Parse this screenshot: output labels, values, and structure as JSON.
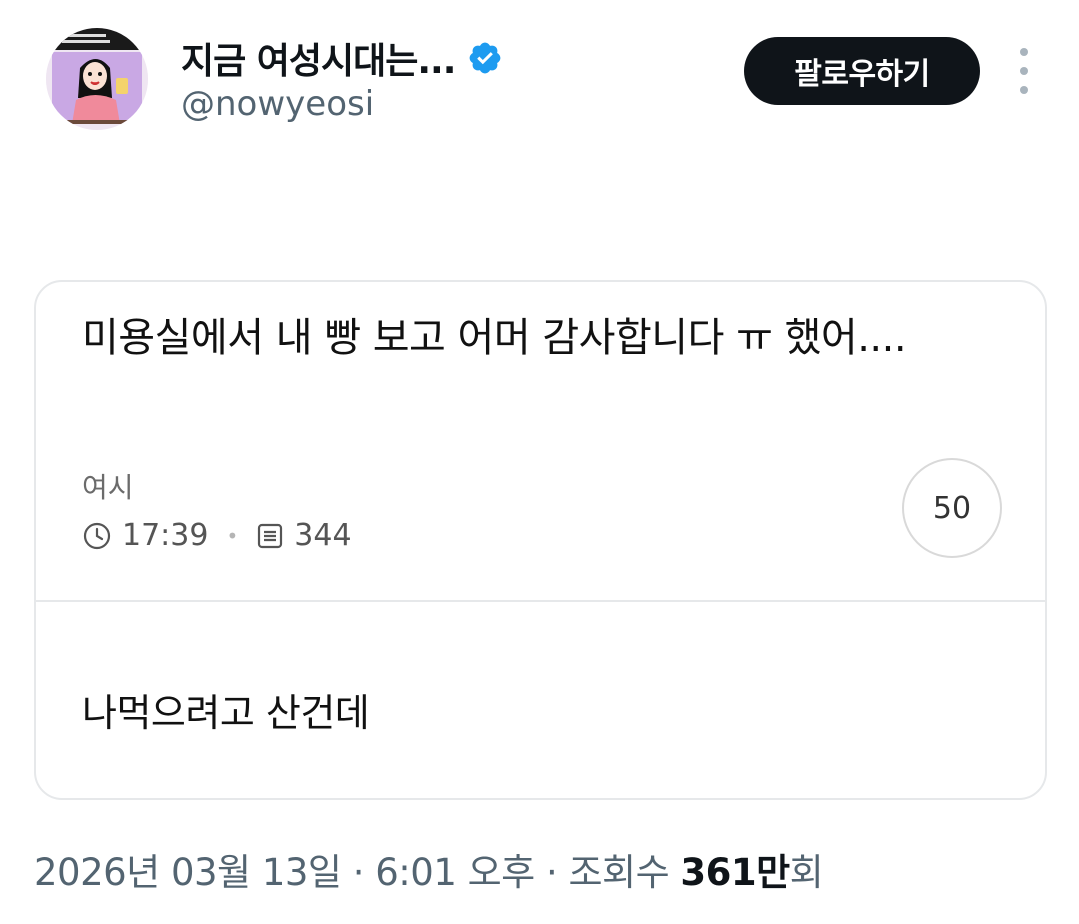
{
  "author": {
    "display_name": "지금 여성시대는...",
    "handle": "@nowyeosi",
    "verified": true,
    "verified_color": "#1d9bf0"
  },
  "actions": {
    "follow_label": "팔로우하기",
    "more_icon": "more-vertical-icon"
  },
  "card": {
    "title": "미용실에서 내 빵 보고 어머 감사합니다 ㅠ 했어....",
    "board": "여시",
    "time": "17:39",
    "views": "344",
    "comments": "50",
    "comment_text": "나먹으려고 산건데"
  },
  "footer": {
    "date": "2026년 03월 13일",
    "time": "6:01 오후",
    "views_label": "조회수",
    "views_number": "361만",
    "views_suffix": "회"
  },
  "colors": {
    "text_primary": "#0f1419",
    "text_secondary": "#536471",
    "follow_bg": "#0f1419",
    "border": "#e6e8ea"
  }
}
